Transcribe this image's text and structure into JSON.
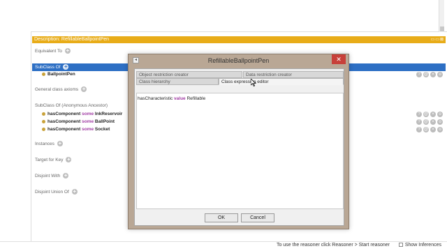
{
  "background": {
    "description_bar": "Description: RefillableBallpointPen",
    "description_controls": "▭▭⊠",
    "sections": {
      "equivalent_to": "Equivalent To",
      "subclass_of": "SubClass Of",
      "general_class_axioms": "General class axioms",
      "subclass_of_anon": "SubClass Of (Anonymous Ancestor)",
      "instances": "Instances",
      "target_for_key": "Target for Key",
      "disjoint_with": "Disjoint With",
      "disjoint_union_of": "Disjoint Union Of"
    },
    "superclass": "BallpointPen",
    "anonymous_axioms": [
      {
        "prop": "hasComponent",
        "kw": "some",
        "filler": "InkReservoir"
      },
      {
        "prop": "hasComponent",
        "kw": "some",
        "filler": "BallPoint"
      },
      {
        "prop": "hasComponent",
        "kw": "some",
        "filler": "Socket"
      }
    ],
    "add_glyph": "+",
    "status_text": "To use the reasoner click Reasoner > Start reasoner",
    "show_inferences": "Show Inferences"
  },
  "dialog": {
    "title": "RefillableBallpointPen",
    "close_glyph": "✕",
    "tabs": {
      "object_restriction": "Object restriction creator",
      "data_restriction": "Data restriction creator",
      "class_hierarchy": "Class hierarchy",
      "class_expression": "Class expression editor"
    },
    "expression": {
      "prop": "hasCharacteristic",
      "kw": "value",
      "filler": "Refillable"
    },
    "ok_label": "OK",
    "cancel_label": "Cancel"
  },
  "colors": {
    "description_bar": "#e8ac18",
    "selection": "#2d6fc4",
    "keyword": "#a03aa3",
    "dialog_frame": "#b9a795",
    "close_button": "#c7403a"
  }
}
